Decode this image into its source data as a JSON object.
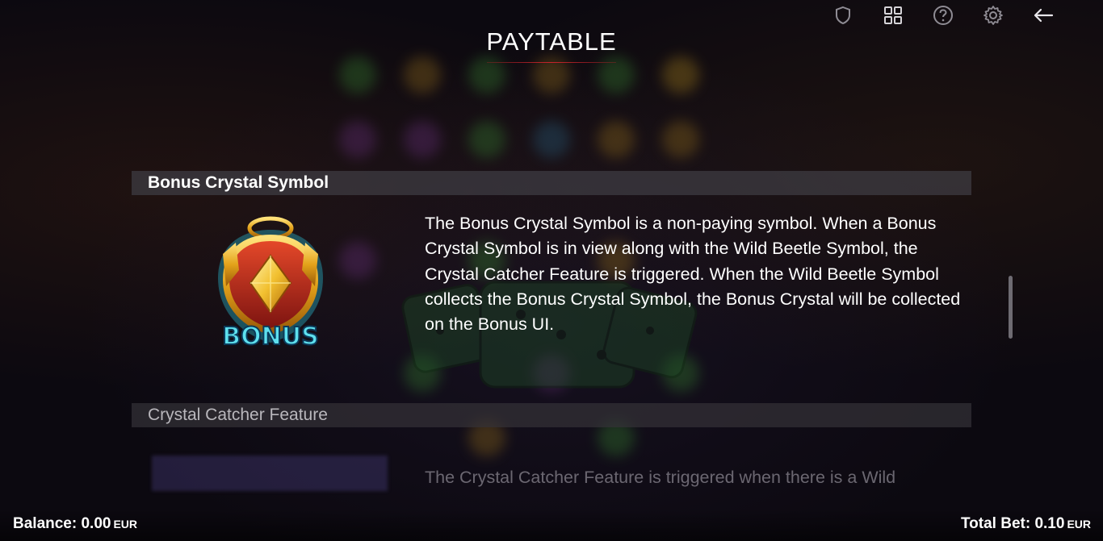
{
  "header": {
    "title": "PAYTABLE"
  },
  "toolbar": {
    "icons": [
      "shield-icon",
      "grid-icon",
      "help-icon",
      "settings-icon",
      "back-arrow-icon"
    ]
  },
  "sections": [
    {
      "heading": "Bonus Crystal Symbol",
      "symbol_label": "BONUS",
      "description": "The Bonus Crystal Symbol is a non-paying symbol. When a Bonus Crystal Symbol is in view along with the Wild Beetle Symbol, the Crystal Catcher Feature is triggered. When the Wild Beetle Symbol collects the Bonus Crystal Symbol, the Bonus Crystal will be collected on the Bonus UI."
    },
    {
      "heading": "Crystal Catcher Feature",
      "description": "The Crystal Catcher Feature is triggered when there is a Wild"
    }
  ],
  "footer": {
    "balance_label": "Balance:",
    "balance_value": "0.00",
    "balance_currency": "EUR",
    "bet_label": "Total Bet:",
    "bet_value": "0.10",
    "bet_currency": "EUR"
  },
  "colors": {
    "accent_red": "#c8232a",
    "header_bar": "#3c3a40",
    "background": "#0c0910"
  }
}
